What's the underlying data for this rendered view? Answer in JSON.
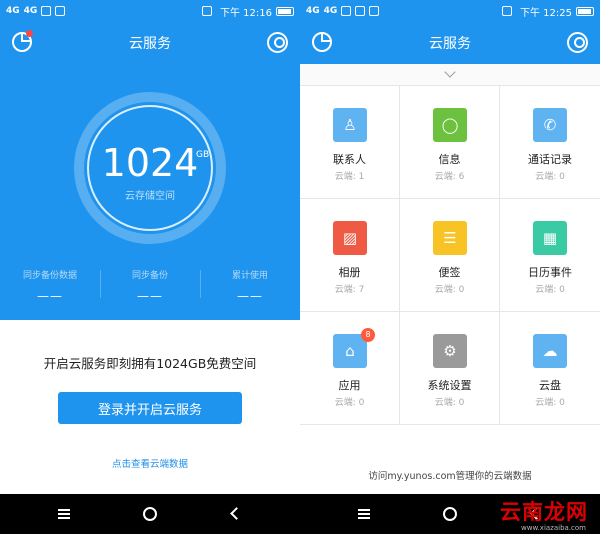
{
  "left": {
    "status": {
      "signal": "4G",
      "network": "4G",
      "time": "下午 12:16"
    },
    "title": "云服务",
    "storage": {
      "value": "1024",
      "unit": "GB",
      "label": "云存储空间"
    },
    "stats": [
      {
        "label": "同步备份数据",
        "value": "——"
      },
      {
        "label": "同步备份",
        "value": "——"
      },
      {
        "label": "累计使用",
        "value": "——"
      }
    ],
    "promo": "开启云服务即刻拥有1024GB免费空间",
    "login_button": "登录并开启云服务",
    "view_link": "点击查看云端数据"
  },
  "right": {
    "status": {
      "signal": "4G",
      "network": "4G",
      "time": "下午 12:25"
    },
    "title": "云服务",
    "items": [
      {
        "name": "联系人",
        "count": "云端: 1",
        "icon": "contacts-icon",
        "color": "#5fb3f0",
        "glyph": "♙"
      },
      {
        "name": "信息",
        "count": "云端: 6",
        "icon": "message-icon",
        "color": "#6cc13e",
        "glyph": "◯"
      },
      {
        "name": "通话记录",
        "count": "云端: 0",
        "icon": "phone-icon",
        "color": "#5fb3f0",
        "glyph": "✆"
      },
      {
        "name": "相册",
        "count": "云端: 7",
        "icon": "photo-icon",
        "color": "#ee5a43",
        "glyph": "▨"
      },
      {
        "name": "便签",
        "count": "云端: 0",
        "icon": "notes-icon",
        "color": "#f7c325",
        "glyph": "☰"
      },
      {
        "name": "日历事件",
        "count": "云端: 0",
        "icon": "calendar-icon",
        "color": "#3bcba4",
        "glyph": "▦"
      },
      {
        "name": "应用",
        "count": "云端: 0",
        "icon": "app-icon",
        "color": "#5fb3f0",
        "glyph": "⌂",
        "badge": "8"
      },
      {
        "name": "系统设置",
        "count": "云端: 0",
        "icon": "settings-icon",
        "color": "#9a9a9a",
        "glyph": "⚙"
      },
      {
        "name": "云盘",
        "count": "云端: 0",
        "icon": "cloud-icon",
        "color": "#5fb3f0",
        "glyph": "☁"
      }
    ],
    "footer": "访问my.yunos.com管理你的云端数据"
  },
  "watermark": {
    "main": "云南龙网",
    "sub": "www.xiazaiba.com"
  },
  "colors": {
    "primary": "#1f94ee"
  }
}
